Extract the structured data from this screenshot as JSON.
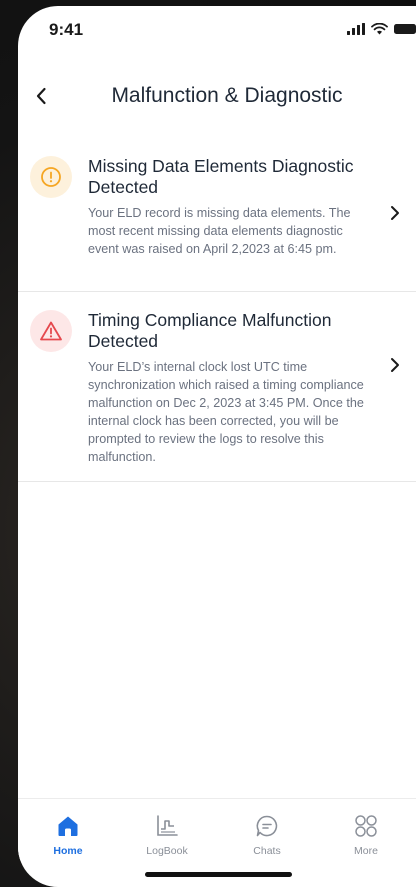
{
  "status_bar": {
    "time": "9:41",
    "icons": [
      "signal-icon",
      "wifi-icon",
      "battery-icon"
    ]
  },
  "header": {
    "back_icon": "chevron-left-icon",
    "title": "Malfunction & Diagnostic"
  },
  "alerts": [
    {
      "icon": "warning-circle-icon",
      "icon_color": "#f5a623",
      "title": "Missing Data Elements Diagnostic Detected",
      "description": "Your ELD record is missing data elements. The most recent missing data elements diagnostic event was raised on April 2,2023 at 6:45 pm."
    },
    {
      "icon": "warning-triangle-icon",
      "icon_color": "#e5484d",
      "title": "Timing Compliance Malfunction Detected",
      "description": "Your ELD’s internal clock lost UTC time synchronization which raised a timing compliance malfunction on Dec 2, 2023 at 3:45 PM. Once the internal clock has been corrected, you will be prompted to review the logs to resolve this malfunction."
    }
  ],
  "bottom_nav": {
    "items": [
      {
        "label": "Home",
        "icon": "home-icon",
        "active": true
      },
      {
        "label": "LogBook",
        "icon": "logbook-icon",
        "active": false
      },
      {
        "label": "Chats",
        "icon": "chat-icon",
        "active": false
      },
      {
        "label": "More",
        "icon": "grid-icon",
        "active": false
      }
    ]
  },
  "colors": {
    "accent": "#1e6fe0",
    "warning": "#f5a623",
    "error": "#e5484d"
  }
}
